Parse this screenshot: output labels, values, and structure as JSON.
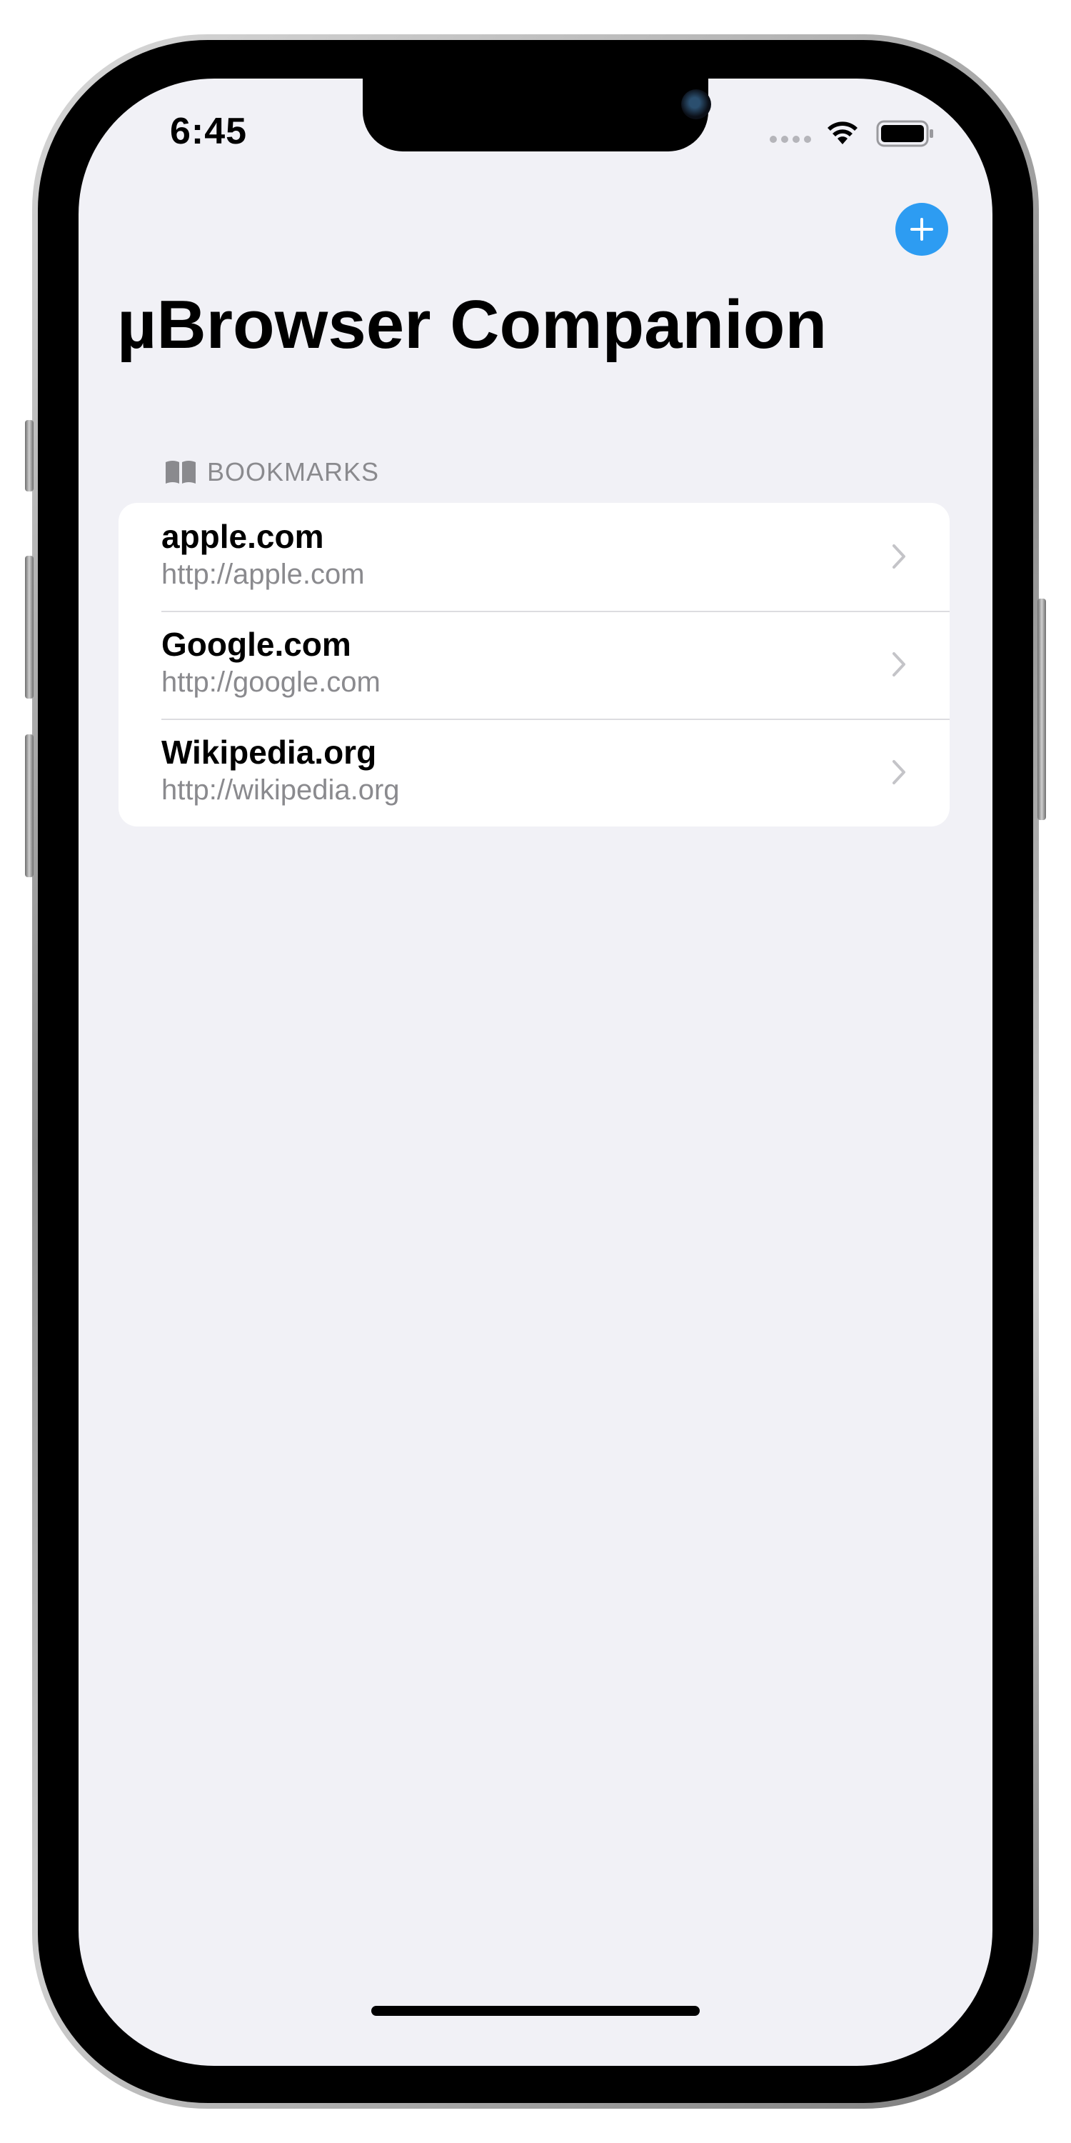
{
  "status_bar": {
    "time": "6:45"
  },
  "header": {
    "title": "µBrowser Companion",
    "add_button_icon": "plus-icon"
  },
  "bookmarks": {
    "section_label": "BOOKMARKS",
    "section_icon": "book-icon",
    "items": [
      {
        "title": "apple.com",
        "url": "http://apple.com"
      },
      {
        "title": "Google.com",
        "url": "http://google.com"
      },
      {
        "title": "Wikipedia.org",
        "url": "http://wikipedia.org"
      }
    ]
  },
  "colors": {
    "accent": "#2d9cf2",
    "background": "#f1f1f6",
    "secondary_text": "#8a8a8e"
  }
}
